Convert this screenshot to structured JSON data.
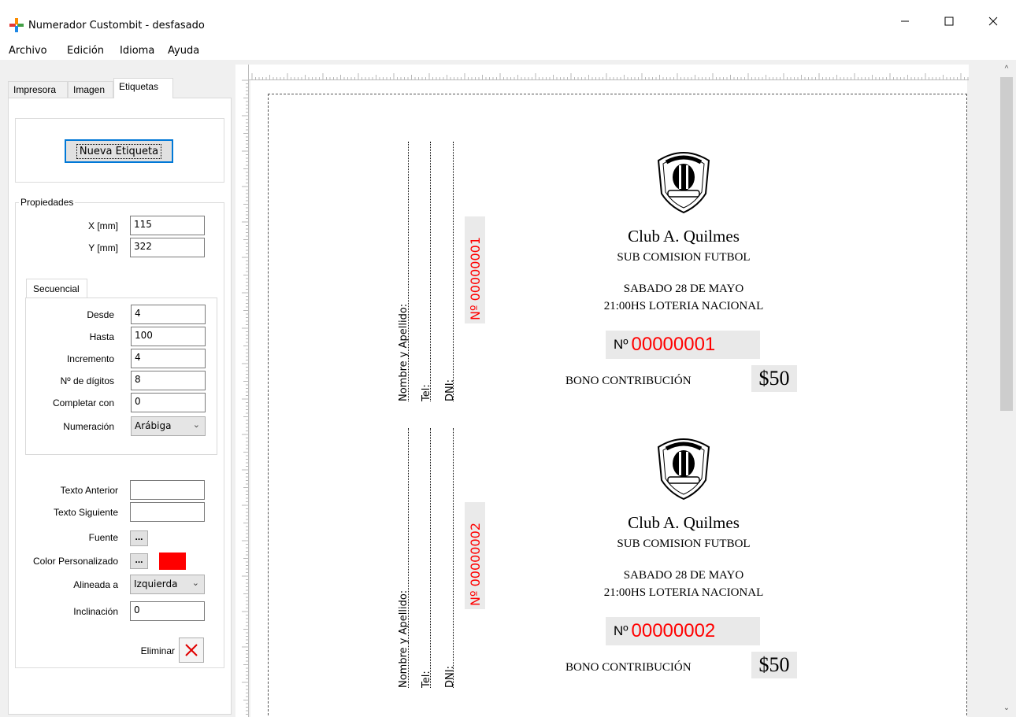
{
  "window": {
    "title": "Numerador Custombit - desfasado"
  },
  "menu": [
    "Archivo",
    "Edición",
    "Idioma",
    "Ayuda"
  ],
  "tabs": [
    "Impresora",
    "Imagen",
    "Etiquetas"
  ],
  "new_label_button": "Nueva Etiqueta",
  "properties": {
    "group_label": "Propiedades",
    "x_label": "X [mm]",
    "x_value": "115",
    "y_label": "Y [mm]",
    "y_value": "322"
  },
  "sequential": {
    "tab_label": "Secuencial",
    "desde_label": "Desde",
    "desde": "4",
    "hasta_label": "Hasta",
    "hasta": "100",
    "incremento_label": "Incremento",
    "incremento": "4",
    "digitos_label": "Nº de dígitos",
    "digitos": "8",
    "completar_label": "Completar con",
    "completar": "0",
    "numeracion_label": "Numeración",
    "numeracion": "Arábiga"
  },
  "text_props": {
    "anterior_label": "Texto Anterior",
    "anterior": "",
    "siguiente_label": "Texto Siguiente",
    "siguiente": "",
    "fuente_label": "Fuente",
    "color_label": "Color Personalizado",
    "color": "#ff0000",
    "alineada_label": "Alineada a",
    "alineada": "Izquierda",
    "inclinacion_label": "Inclinación",
    "inclinacion": "0",
    "eliminar_label": "Eliminar",
    "ellipsis": "..."
  },
  "tickets": [
    {
      "stub_name": "Nombre y Apellido:",
      "stub_tel": "Tel:",
      "stub_dni": "DNI:",
      "stub_number": "Nº  00000001",
      "club": "Club A. Quilmes",
      "subtitle": "SUB COMISION FUTBOL",
      "date": "SABADO 28 DE MAYO",
      "draw": "21:00HS LOTERIA NACIONAL",
      "num_prefix": "Nº",
      "number": "00000001",
      "bono": "BONO CONTRIBUCIÓN",
      "price": "$50"
    },
    {
      "stub_name": "Nombre y Apellido:",
      "stub_tel": "Tel:",
      "stub_dni": "DNI:",
      "stub_number": "Nº  00000002",
      "club": "Club A. Quilmes",
      "subtitle": "SUB COMISION FUTBOL",
      "date": "SABADO 28 DE MAYO",
      "draw": "21:00HS LOTERIA NACIONAL",
      "num_prefix": "Nº",
      "number": "00000002",
      "bono": "BONO CONTRIBUCIÓN",
      "price": "$50"
    }
  ],
  "colors": {
    "accent": "#0078d7",
    "number_red": "#ff0000"
  }
}
